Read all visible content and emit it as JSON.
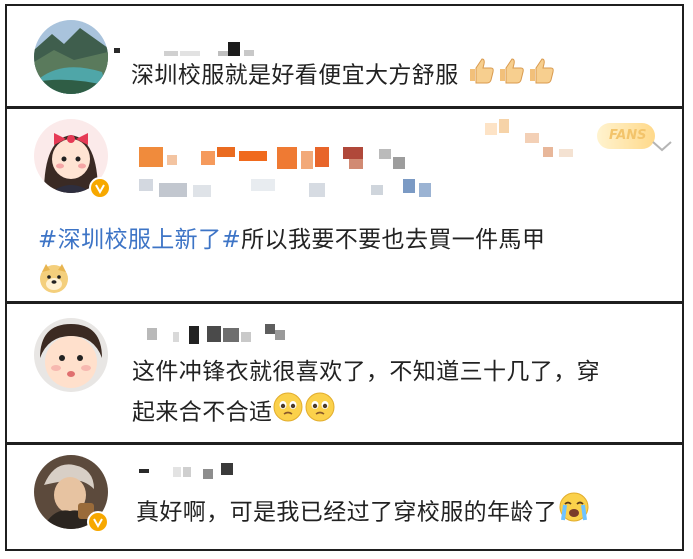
{
  "comments": [
    {
      "text": "深圳校服就是好看便宜大方舒服",
      "emojis": [
        "thumbs-up-icon",
        "thumbs-up-icon",
        "thumbs-up-icon"
      ]
    },
    {
      "hashtag": "#深圳校服上新了#",
      "text": "所以我要不要也去買一件馬甲",
      "badge": "FANS",
      "emojis": [
        "doge-icon"
      ]
    },
    {
      "text_line1": "这件冲锋衣就很喜欢了，不知道三十几了，穿",
      "text_line2": "起来合不合适",
      "emojis": [
        "pleading-face-icon",
        "pleading-face-icon"
      ]
    },
    {
      "text": "真好啊，可是我已经过了穿校服的年龄了",
      "emojis": [
        "loudly-crying-face-icon"
      ]
    }
  ],
  "colors": {
    "hashtag": "#3d74c6",
    "verified_badge": "#f7a800",
    "border": "#1f1f1f",
    "text": "#222222"
  }
}
